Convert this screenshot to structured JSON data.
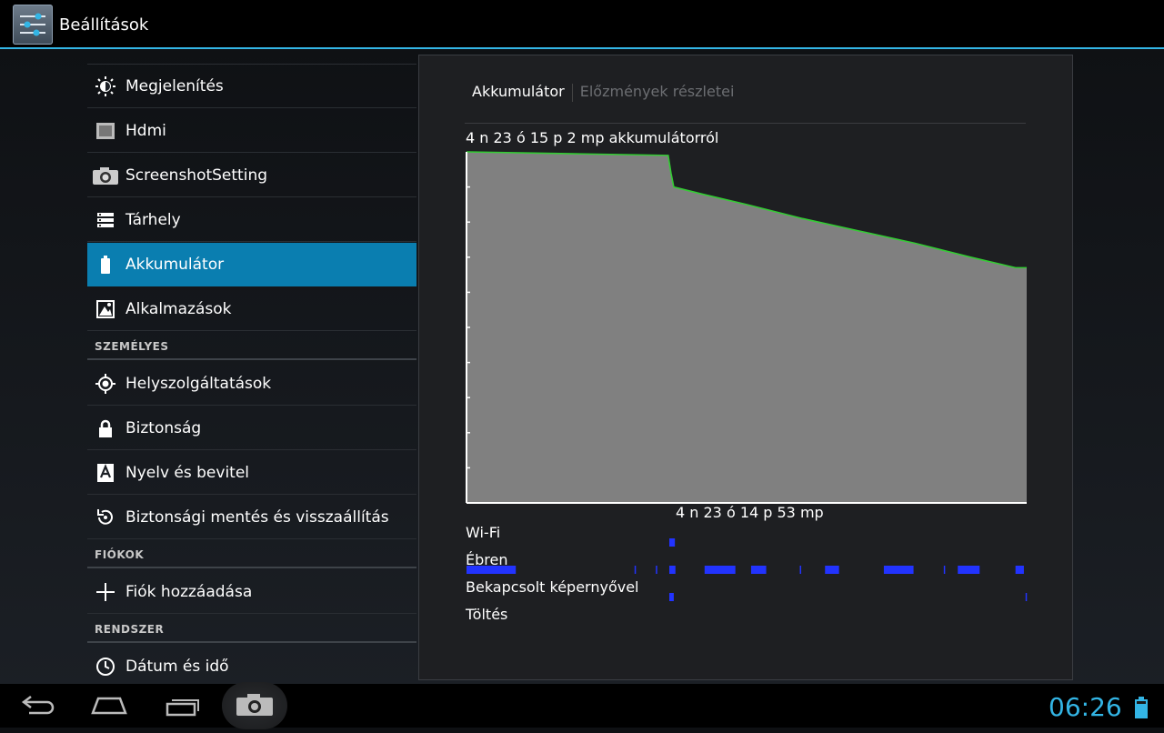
{
  "app": {
    "title": "Beállítások",
    "icon": "settings-sliders-icon"
  },
  "sidebar": {
    "items": [
      {
        "label": "Megjelenítés",
        "icon": "brightness-icon"
      },
      {
        "label": "Hdmi",
        "icon": "hdmi-icon"
      },
      {
        "label": "ScreenshotSetting",
        "icon": "camera-icon"
      },
      {
        "label": "Tárhely",
        "icon": "storage-icon"
      },
      {
        "label": "Akkumulátor",
        "icon": "battery-icon"
      },
      {
        "label": "Alkalmazások",
        "icon": "apps-icon"
      }
    ],
    "personal_header": "SZEMÉLYES",
    "personal_items": [
      {
        "label": "Helyszolgáltatások",
        "icon": "location-icon"
      },
      {
        "label": "Biztonság",
        "icon": "lock-icon"
      },
      {
        "label": "Nyelv és bevitel",
        "icon": "keyboard-language-icon"
      },
      {
        "label": "Biztonsági mentés és visszaállítás",
        "icon": "backup-restore-icon"
      }
    ],
    "accounts_header": "FIÓKOK",
    "account_items": [
      {
        "label": "Fiók hozzáadása",
        "icon": "plus-icon"
      }
    ],
    "system_header": "RENDSZER",
    "system_items": [
      {
        "label": "Dátum és idő",
        "icon": "clock-icon"
      }
    ],
    "selected": "Akkumulátor"
  },
  "detail": {
    "tabs": {
      "active": "Akkumulátor",
      "inactive": "Előzmények részletei"
    },
    "since_label": "4 n 23 ó 15 p 2 mp akkumulátorról",
    "end_label": "4 n 23 ó 14 p 53 mp",
    "tracks": [
      "Wi-Fi",
      "Ébren",
      "Bekapcsolt képernyővel",
      "Töltés"
    ]
  },
  "chart_data": {
    "type": "area",
    "ylim": [
      0,
      100
    ],
    "grid": false,
    "x": [
      0,
      0.18,
      0.36,
      0.365,
      0.37,
      0.42,
      0.5,
      0.6,
      0.7,
      0.8,
      0.9,
      0.98,
      1.0
    ],
    "values": [
      100,
      99.5,
      99,
      94,
      90,
      88,
      85,
      81,
      77.5,
      74,
      70,
      67,
      67
    ],
    "wifi_segments": [
      [
        0.362,
        0.372
      ]
    ],
    "awake_segments": [
      [
        0.0,
        0.088
      ],
      [
        0.3,
        0.302
      ],
      [
        0.338,
        0.34
      ],
      [
        0.362,
        0.373
      ],
      [
        0.425,
        0.48
      ],
      [
        0.508,
        0.535
      ],
      [
        0.595,
        0.597
      ],
      [
        0.64,
        0.665
      ],
      [
        0.745,
        0.798
      ],
      [
        0.852,
        0.854
      ],
      [
        0.877,
        0.916
      ],
      [
        0.98,
        0.995
      ]
    ],
    "screen_segments": [
      [
        0.362,
        0.37
      ],
      [
        0.998,
        1.0
      ]
    ],
    "charging_segments": [],
    "colors": {
      "line": "#33cc33",
      "fill": "#808080",
      "bars": "#2233ff",
      "axis": "#ffffff"
    }
  },
  "navbar": {
    "buttons": [
      "back-icon",
      "home-icon",
      "recent-apps-icon",
      "screenshot-camera-icon"
    ],
    "clock": "06:26",
    "battery_icon": "battery-status-icon"
  }
}
